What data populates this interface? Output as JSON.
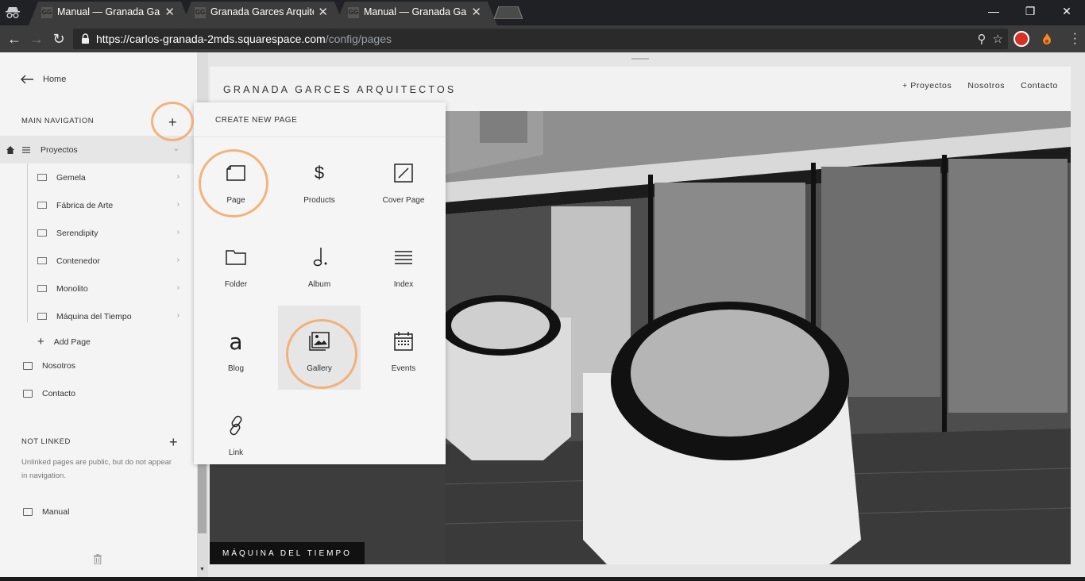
{
  "browser": {
    "tabs": [
      {
        "title": "Manual — Granada Garces Arquitectos",
        "favicon": "GG",
        "active": false
      },
      {
        "title": "Granada Garces Arquitectos",
        "favicon": "GG",
        "active": true
      },
      {
        "title": "Manual — Granada Garces Arquitectos",
        "favicon": "GG",
        "active": false
      }
    ],
    "url_host": "https://carlos-granada-2mds.squarespace.com",
    "url_path": "/config/pages"
  },
  "sidebar": {
    "back_label": "Home",
    "main_nav_title": "MAIN NAVIGATION",
    "folder": {
      "label": "Proyectos"
    },
    "sub_items": [
      {
        "label": "Gemela"
      },
      {
        "label": "Fábrica de Arte"
      },
      {
        "label": "Serendipity"
      },
      {
        "label": "Contenedor"
      },
      {
        "label": "Monolito"
      },
      {
        "label": "Máquina del Tiempo"
      }
    ],
    "add_page_label": "Add Page",
    "top_pages": [
      {
        "label": "Nosotros"
      },
      {
        "label": "Contacto"
      }
    ],
    "not_linked_title": "NOT LINKED",
    "not_linked_note": "Unlinked pages are public, but do not appear in navigation.",
    "unlinked_pages": [
      {
        "label": "Manual"
      }
    ]
  },
  "popover": {
    "title": "CREATE NEW PAGE",
    "tiles": [
      {
        "label": "Page",
        "icon": "page-icon"
      },
      {
        "label": "Products",
        "icon": "dollar-icon"
      },
      {
        "label": "Cover Page",
        "icon": "cover-page-icon"
      },
      {
        "label": "Folder",
        "icon": "folder-icon"
      },
      {
        "label": "Album",
        "icon": "music-note-icon"
      },
      {
        "label": "Index",
        "icon": "index-lines-icon"
      },
      {
        "label": "Blog",
        "icon": "blog-letter-icon"
      },
      {
        "label": "Gallery",
        "icon": "gallery-image-icon"
      },
      {
        "label": "Events",
        "icon": "calendar-icon"
      },
      {
        "label": "Link",
        "icon": "link-icon"
      }
    ],
    "blog_glyph": "a",
    "products_glyph": "$"
  },
  "site": {
    "title": "GRANADA GARCES ARQUITECTOS",
    "nav": [
      "+ Proyectos",
      "Nosotros",
      "Contacto"
    ],
    "caption": "MÁQUINA DEL TIEMPO"
  },
  "colors": {
    "annotation": "#f3a765",
    "chrome_dark": "#202124",
    "chrome_toolbar": "#3c3c3c"
  }
}
